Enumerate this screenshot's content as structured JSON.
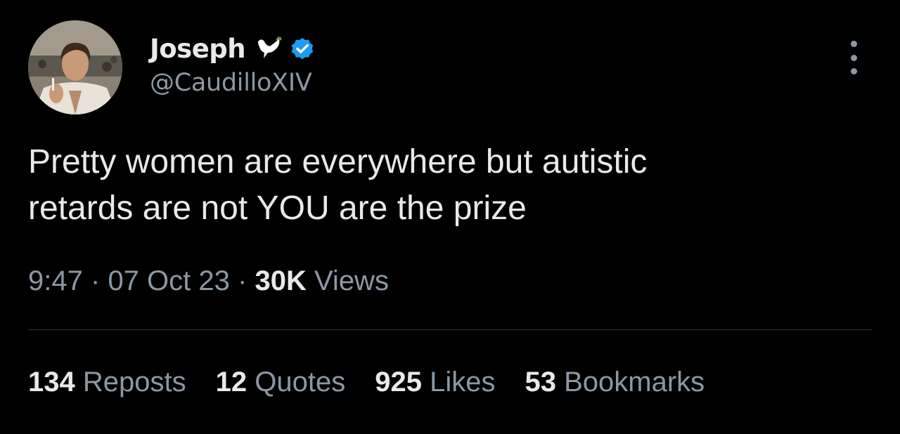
{
  "author": {
    "display_name": "Joseph",
    "handle": "@CaudilloXIV",
    "icons": [
      "dove-icon",
      "verified-icon"
    ],
    "verified_color": "#1d9bf0"
  },
  "tweet": {
    "text_line1": "Pretty women are everywhere but autistic",
    "text_line2": "retards are not YOU are the prize"
  },
  "meta": {
    "time": "9:47",
    "sep1": "·",
    "date": "07 Oct 23",
    "sep2": "·",
    "views_count": "30K",
    "views_label": "Views"
  },
  "stats": {
    "reposts": {
      "count": "134",
      "label": "Reposts"
    },
    "quotes": {
      "count": "12",
      "label": "Quotes"
    },
    "likes": {
      "count": "925",
      "label": "Likes"
    },
    "bookmarks": {
      "count": "53",
      "label": "Bookmarks"
    }
  },
  "colors": {
    "background": "#000000",
    "text_primary": "#e7e9ea",
    "text_secondary": "#8b98a5",
    "divider": "#2f3336"
  }
}
